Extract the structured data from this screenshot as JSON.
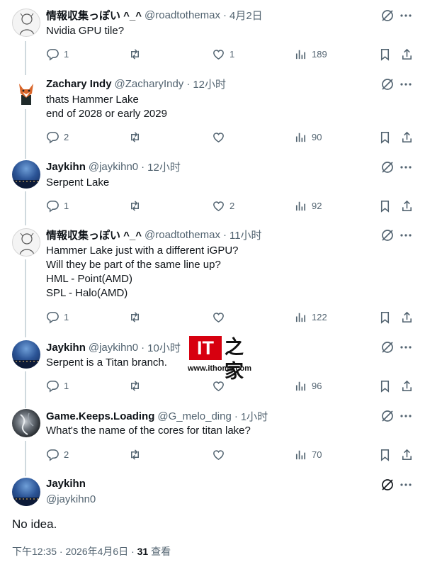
{
  "tweets": [
    {
      "name": "情報収集っぽい ^_^",
      "handle": "@roadtothemax",
      "time": "4月2日",
      "lines": [
        "Nvidia GPU tile?"
      ],
      "replies": "1",
      "retweets": "",
      "likes": "1",
      "views": "189"
    },
    {
      "name": "Zachary Indy",
      "handle": "@ZacharyIndy",
      "time": "12小时",
      "lines": [
        "thats Hammer Lake",
        "end of 2028 or early 2029"
      ],
      "replies": "2",
      "retweets": "",
      "likes": "",
      "views": "90"
    },
    {
      "name": "Jaykihn",
      "handle": "@jaykihn0",
      "time": "12小时",
      "lines": [
        "Serpent Lake"
      ],
      "replies": "1",
      "retweets": "",
      "likes": "2",
      "views": "92"
    },
    {
      "name": "情報収集っぽい ^_^",
      "handle": "@roadtothemax",
      "time": "11小时",
      "lines": [
        "Hammer Lake just with a different iGPU?",
        "Will they be part of the same line up?",
        "HML - Point(AMD)",
        "SPL - Halo(AMD)"
      ],
      "replies": "1",
      "retweets": "",
      "likes": "",
      "views": "122"
    },
    {
      "name": "Jaykihn",
      "handle": "@jaykihn0",
      "time": "10小时",
      "lines": [
        "Serpent is a Titan branch."
      ],
      "replies": "1",
      "retweets": "",
      "likes": "",
      "views": "96"
    },
    {
      "name": "Game.Keeps.Loading",
      "handle": "@G_melo_ding",
      "time": "1小时",
      "lines": [
        "What's the name of the cores for titan lake?"
      ],
      "replies": "2",
      "retweets": "",
      "likes": "",
      "views": "70"
    }
  ],
  "main_tweet": {
    "name": "Jaykihn",
    "handle": "@jaykihn0",
    "text": "No idea.",
    "timestamp": "下午12:35 · 2026年4月6日 · ",
    "views": "31",
    "views_label": " 查看"
  },
  "watermark": {
    "logo_text": "IT",
    "han_text": "之家",
    "url": "www.ithome.com"
  },
  "colors": {
    "text": "#0f1419",
    "secondary": "#536471",
    "thread_line": "#cfd9de",
    "brand_red": "#d7000f"
  }
}
